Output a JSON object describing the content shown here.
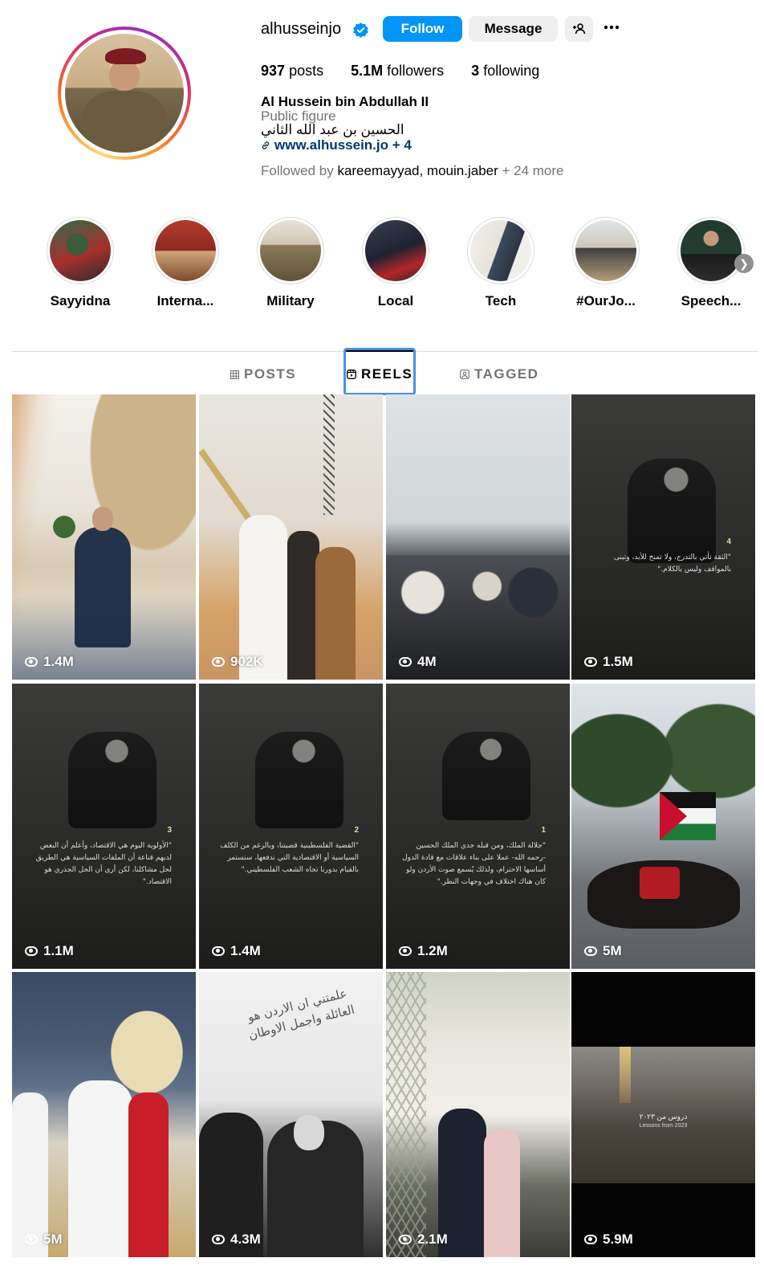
{
  "profile": {
    "username": "alhusseinjo",
    "follow_label": "Follow",
    "message_label": "Message",
    "suggest_icon": "add-person-icon",
    "more_icon": "more-options-icon",
    "posts_count": "937",
    "posts_label": "posts",
    "followers_count": "5.1M",
    "followers_label": "followers",
    "following_count": "3",
    "following_label": "following",
    "full_name": "Al Hussein bin Abdullah II",
    "category": "Public figure",
    "arabic_name": "الحسين بن عبد الله الثاني",
    "link": "www.alhussein.jo + 4",
    "followed_by_prefix": "Followed by ",
    "followed_by_users": "kareemayyad, mouin.jaber",
    "followed_by_suffix": " + 24 more"
  },
  "highlights": [
    {
      "label": "Sayyidna"
    },
    {
      "label": "Interna..."
    },
    {
      "label": "Military"
    },
    {
      "label": "Local"
    },
    {
      "label": "Tech"
    },
    {
      "label": "#OurJo..."
    },
    {
      "label": "Speech..."
    }
  ],
  "tabs": [
    {
      "label": "POSTS",
      "icon": "grid-icon"
    },
    {
      "label": "REELS",
      "icon": "reels-icon"
    },
    {
      "label": "TAGGED",
      "icon": "tagged-icon"
    }
  ],
  "reels": [
    {
      "views": "1.4M"
    },
    {
      "views": "902K"
    },
    {
      "views": "4M"
    },
    {
      "views": "1.5M",
      "quote_num": "4",
      "quote": "\"الثقة تأتي بالتدرج، ولا تمنح للأبد، وتبنى بالمواقف وليس بالكلام.\""
    },
    {
      "views": "1.1M",
      "quote_num": "3",
      "quote": "\"الأولوية اليوم هي الاقتصاد، وأعلم أن البعض لديهم قناعة أن الملفات السياسية هي الطريق لحل مشاكلنا، لكن أرى أن الحل الجذري هو الاقتصاد.\""
    },
    {
      "views": "1.4M",
      "quote_num": "2",
      "quote": "\"القضية الفلسطينية قضيتنا، وبالرغم من الكلف السياسية أو الاقتصادية التي ندفعها، سنستمر بالقيام بدورنا تجاه الشعب الفلسطيني.\""
    },
    {
      "views": "1.2M",
      "quote_num": "1",
      "quote": "\"جلالة الملك، ومن قبله جدي الملك الحسين -رحمه الله- عملا على بناء علاقات مع قادة الدول أساسها الاحترام، ولذلك يُسمع صوت الأردن ولو كان هناك اختلاف في وجهات النظر.\""
    },
    {
      "views": "5M"
    },
    {
      "views": "5M"
    },
    {
      "views": "4.3M",
      "caption": "علمتني ان الاردن هو العائلة واجمل الاوطان"
    },
    {
      "views": "2.1M"
    },
    {
      "views": "5.9M",
      "caption": "دروس من ٢٠٢٣",
      "caption_en": "Lessons from 2023"
    }
  ]
}
